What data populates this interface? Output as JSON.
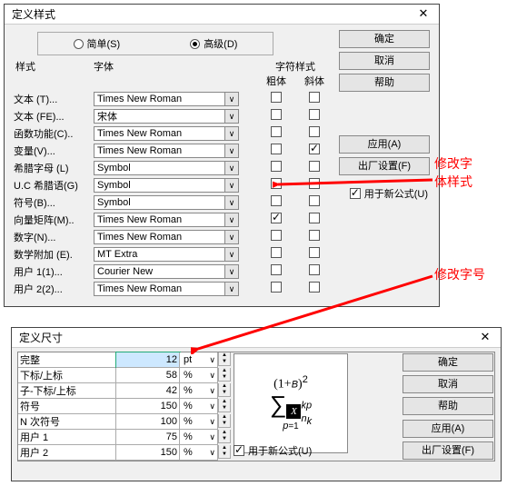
{
  "annotations": {
    "modify_style": "修改字\n体样式",
    "modify_size": "修改字号"
  },
  "close_glyph": "✕",
  "dropdown_glyph": "∨",
  "dialog1": {
    "title": "定义样式",
    "radios": {
      "simple": "简单(S)",
      "advanced": "高级(D)"
    },
    "col_style": "样式",
    "col_font": "字体",
    "col_css": "字符样式",
    "sub_bold": "粗体",
    "sub_italic": "斜体",
    "rows": [
      {
        "label": "文本 (T)...",
        "font": "Times New Roman",
        "bold": false,
        "italic": false
      },
      {
        "label": "文本 (FE)...",
        "font": "宋体",
        "bold": false,
        "italic": false
      },
      {
        "label": "函数功能(C)..",
        "font": "Times New Roman",
        "bold": false,
        "italic": false
      },
      {
        "label": "变量(V)...",
        "font": "Times New Roman",
        "bold": false,
        "italic": true
      },
      {
        "label": "希腊字母 (L)",
        "font": "Symbol",
        "bold": false,
        "italic": false
      },
      {
        "label": "U.C 希腊语(G)",
        "font": "Symbol",
        "bold": false,
        "italic": false
      },
      {
        "label": "符号(B)...",
        "font": "Symbol",
        "bold": false,
        "italic": false
      },
      {
        "label": "向量矩阵(M)..",
        "font": "Times New Roman",
        "bold": true,
        "italic": false
      },
      {
        "label": "数字(N)...",
        "font": "Times New Roman",
        "bold": false,
        "italic": false
      },
      {
        "label": "数学附加 (E).",
        "font": "MT Extra",
        "bold": false,
        "italic": false
      },
      {
        "label": "用户 1(1)...",
        "font": "Courier New",
        "bold": false,
        "italic": false
      },
      {
        "label": "用户 2(2)...",
        "font": "Times New Roman",
        "bold": false,
        "italic": false
      }
    ],
    "buttons": {
      "ok": "确定",
      "cancel": "取消",
      "help": "帮助",
      "apply": "应用(A)",
      "factory": "出厂设置(F)"
    },
    "use_new": "用于新公式(U)"
  },
  "dialog2": {
    "title": "定义尺寸",
    "rows": [
      {
        "label": "完整",
        "value": "12",
        "unit": "pt",
        "highlight": true
      },
      {
        "label": "下标/上标",
        "value": "58",
        "unit": "%",
        "highlight": false
      },
      {
        "label": "子-下标/上标",
        "value": "42",
        "unit": "%",
        "highlight": false
      },
      {
        "label": "符号",
        "value": "150",
        "unit": "%",
        "highlight": false
      },
      {
        "label": "N 次符号",
        "value": "100",
        "unit": "%",
        "highlight": false
      },
      {
        "label": "用户 1",
        "value": "75",
        "unit": "%",
        "highlight": false
      },
      {
        "label": "用户 2",
        "value": "150",
        "unit": "%",
        "highlight": false
      }
    ],
    "buttons": {
      "ok": "确定",
      "cancel": "取消",
      "help": "帮助",
      "apply": "应用(A)",
      "factory": "出厂设置(F)"
    },
    "use_new": "用于新公式(U)",
    "preview_formula": "(1+B)² Σ X kp / p=1 n_k"
  }
}
